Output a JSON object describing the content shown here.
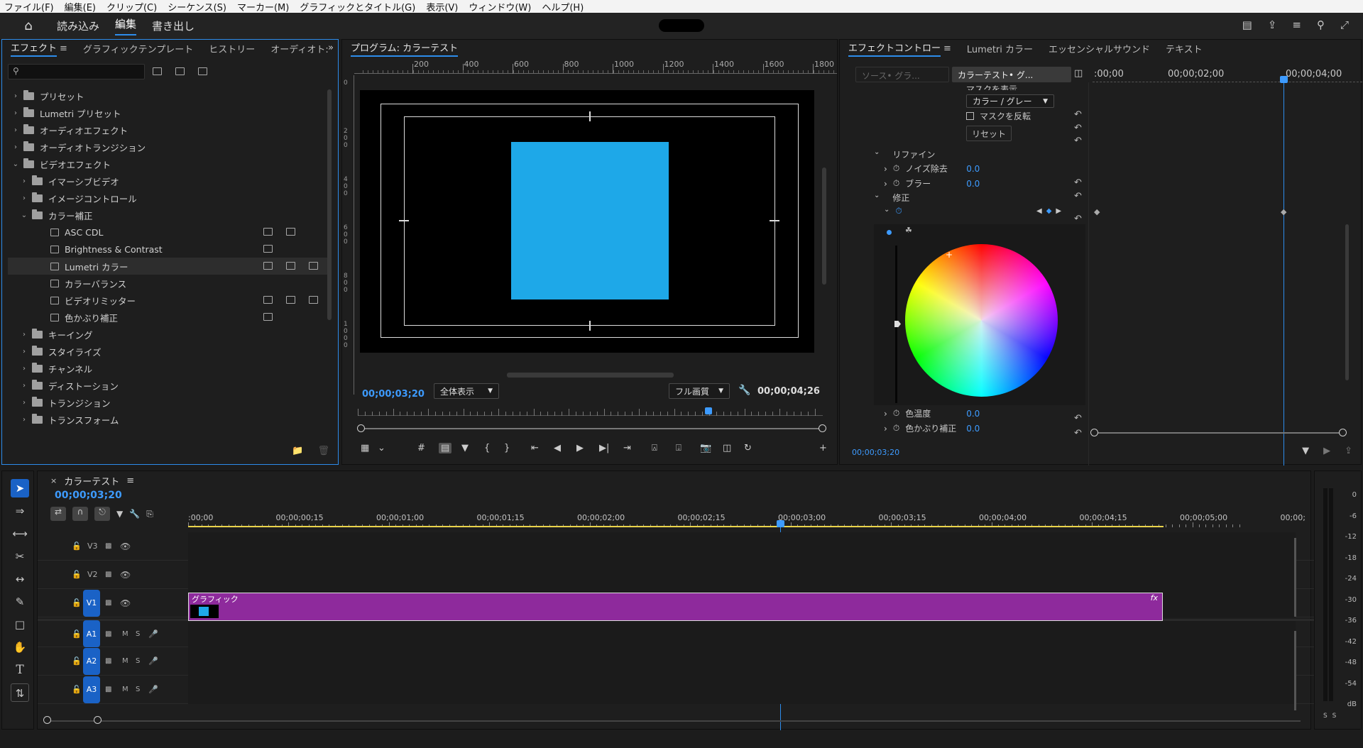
{
  "menu": [
    "ファイル(F)",
    "編集(E)",
    "クリップ(C)",
    "シーケンス(S)",
    "マーカー(M)",
    "グラフィックとタイトル(G)",
    "表示(V)",
    "ウィンドウ(W)",
    "ヘルプ(H)"
  ],
  "workspaces": {
    "import": "読み込み",
    "edit": "編集",
    "export": "書き出し"
  },
  "effects_panel": {
    "tabs": [
      "エフェクト",
      "グラフィックテンプレート",
      "ヒストリー",
      "オーディオト:"
    ],
    "search_placeholder": "",
    "tree": [
      {
        "label": "プリセット",
        "level": 0,
        "type": "special",
        "open": false
      },
      {
        "label": "Lumetri プリセット",
        "level": 0,
        "type": "special",
        "open": false
      },
      {
        "label": "オーディオエフェクト",
        "level": 0,
        "type": "folder",
        "open": false
      },
      {
        "label": "オーディオトランジション",
        "level": 0,
        "type": "folder",
        "open": false
      },
      {
        "label": "ビデオエフェクト",
        "level": 0,
        "type": "folder",
        "open": true
      },
      {
        "label": "イマーシブビデオ",
        "level": 1,
        "type": "folder",
        "open": false
      },
      {
        "label": "イメージコントロール",
        "level": 1,
        "type": "folder",
        "open": false
      },
      {
        "label": "カラー補正",
        "level": 1,
        "type": "folder",
        "open": true
      },
      {
        "label": "ASC CDL",
        "level": 2,
        "type": "fx",
        "badges": 2
      },
      {
        "label": "Brightness & Contrast",
        "level": 2,
        "type": "fx",
        "badges": 1
      },
      {
        "label": "Lumetri カラー",
        "level": 2,
        "type": "fx",
        "badges": 3,
        "selected": true
      },
      {
        "label": "カラーバランス",
        "level": 2,
        "type": "fx",
        "badges": 0
      },
      {
        "label": "ビデオリミッター",
        "level": 2,
        "type": "fx",
        "badges": 3
      },
      {
        "label": "色かぶり補正",
        "level": 2,
        "type": "fx",
        "badges": 1
      },
      {
        "label": "キーイング",
        "level": 1,
        "type": "folder",
        "open": false
      },
      {
        "label": "スタイライズ",
        "level": 1,
        "type": "folder",
        "open": false
      },
      {
        "label": "チャンネル",
        "level": 1,
        "type": "folder",
        "open": false
      },
      {
        "label": "ディストーション",
        "level": 1,
        "type": "folder",
        "open": false
      },
      {
        "label": "トランジション",
        "level": 1,
        "type": "folder",
        "open": false
      },
      {
        "label": "トランスフォーム",
        "level": 1,
        "type": "folder",
        "open": false
      }
    ]
  },
  "program_monitor": {
    "title": "プログラム: カラーテスト",
    "ruler_h": [
      "200",
      "400",
      "600",
      "800",
      "1000",
      "1200",
      "1400",
      "1600",
      "1800"
    ],
    "ruler_v": [
      "0",
      "200",
      "400",
      "600",
      "800",
      "1000"
    ],
    "current_timecode": "00;00;03;20",
    "zoom": "全体表示",
    "quality": "フル画質",
    "duration": "00;00;04;26",
    "square_color": "#1ea8e8"
  },
  "effect_controls": {
    "tabs": [
      "エフェクトコントロー",
      "Lumetri カラー",
      "エッセンシャルサウンド",
      "テキスト"
    ],
    "source_label": "ソース• グラ...",
    "sequence_label": "カラーテスト• グ...",
    "ruler": [
      ":00;00",
      "00;00;02;00",
      "00;00;04;00"
    ],
    "mode_dropdown": "カラー / グレー",
    "mask_invert": "マスクを反転",
    "mask_show": "マスクを表示",
    "reset": "リセット",
    "refine": "リファイン",
    "noise": {
      "label": "ノイズ除去",
      "value": "0.0"
    },
    "blur": {
      "label": "ブラー",
      "value": "0.0"
    },
    "correction": "修正",
    "temp": {
      "label": "色温度",
      "value": "0.0"
    },
    "tint": {
      "label": "色かぶり補正",
      "value": "0.0"
    },
    "timecode": "00;00;03;20"
  },
  "timeline": {
    "title": "カラーテスト",
    "timecode": "00;00;03;20",
    "ruler": [
      ":00;00",
      "00;00;00;15",
      "00;00;01;00",
      "00;00;01;15",
      "00;00;02;00",
      "00;00;02;15",
      "00;00;03;00",
      "00;00;03;15",
      "00;00;04;00",
      "00;00;04;15",
      "00;00;05;00",
      "00;00;"
    ],
    "tracks": [
      "V3",
      "V2",
      "V1",
      "A1",
      "A2",
      "A3"
    ],
    "clip_label": "グラフィック",
    "clip_fx": "fx",
    "clip_color": "#8e2a9c",
    "playhead_pct": 0.59
  },
  "audio_meter": [
    "0",
    "-6",
    "-12",
    "-18",
    "-24",
    "-30",
    "-36",
    "-42",
    "-48",
    "-54",
    "dB"
  ],
  "meter_footer": "S S",
  "colors": {
    "accent": "#2d8ceb",
    "panel": "#1e1e1e",
    "timecode": "#3d9bff"
  }
}
